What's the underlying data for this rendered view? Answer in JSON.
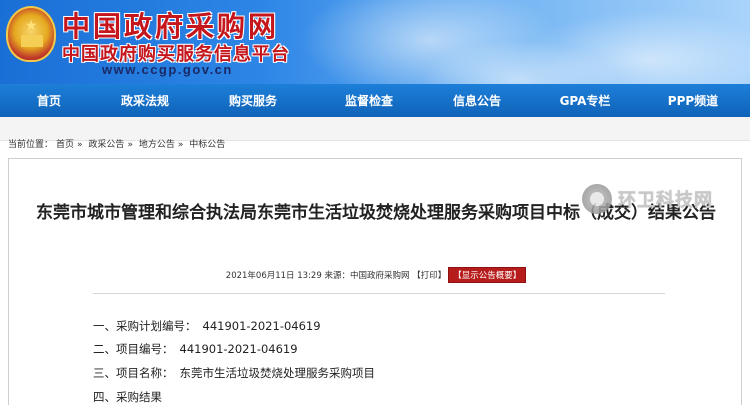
{
  "header": {
    "site_name": "中国政府采购网",
    "site_subtitle": "中国政府购买服务信息平台",
    "url": "www.ccgp.gov.cn"
  },
  "nav": {
    "items": [
      {
        "label": "首页"
      },
      {
        "label": "政采法规"
      },
      {
        "label": "购买服务"
      },
      {
        "label": "监督检查"
      },
      {
        "label": "信息公告"
      },
      {
        "label": "GPA专栏"
      },
      {
        "label": "PPP频道"
      }
    ]
  },
  "breadcrumb": {
    "prefix": "当前位置：",
    "items": [
      "首页",
      "政采公告",
      "地方公告",
      "中标公告"
    ],
    "separator": "»"
  },
  "article": {
    "title": "东莞市城市管理和综合执法局东莞市生活垃圾焚烧处理服务采购项目中标（成交）结果公告",
    "date": "2021年06月11日 13:29",
    "source_label": "来源：",
    "source": "中国政府采购网",
    "print_label": "【打印】",
    "summary_button": "【显示公告概要】",
    "items": [
      {
        "label": "一、采购计划编号：",
        "value": "441901-2021-04619"
      },
      {
        "label": "二、项目编号：",
        "value": "441901-2021-04619"
      },
      {
        "label": "三、项目名称：",
        "value": "东莞市生活垃圾焚烧处理服务采购项目"
      },
      {
        "label": "四、采购结果",
        "value": ""
      }
    ]
  },
  "watermark": {
    "text": "环卫科技网"
  },
  "colors": {
    "nav_bg": "#0f63b8",
    "site_name": "#c4161c",
    "summary_button": "#b71c1c"
  }
}
